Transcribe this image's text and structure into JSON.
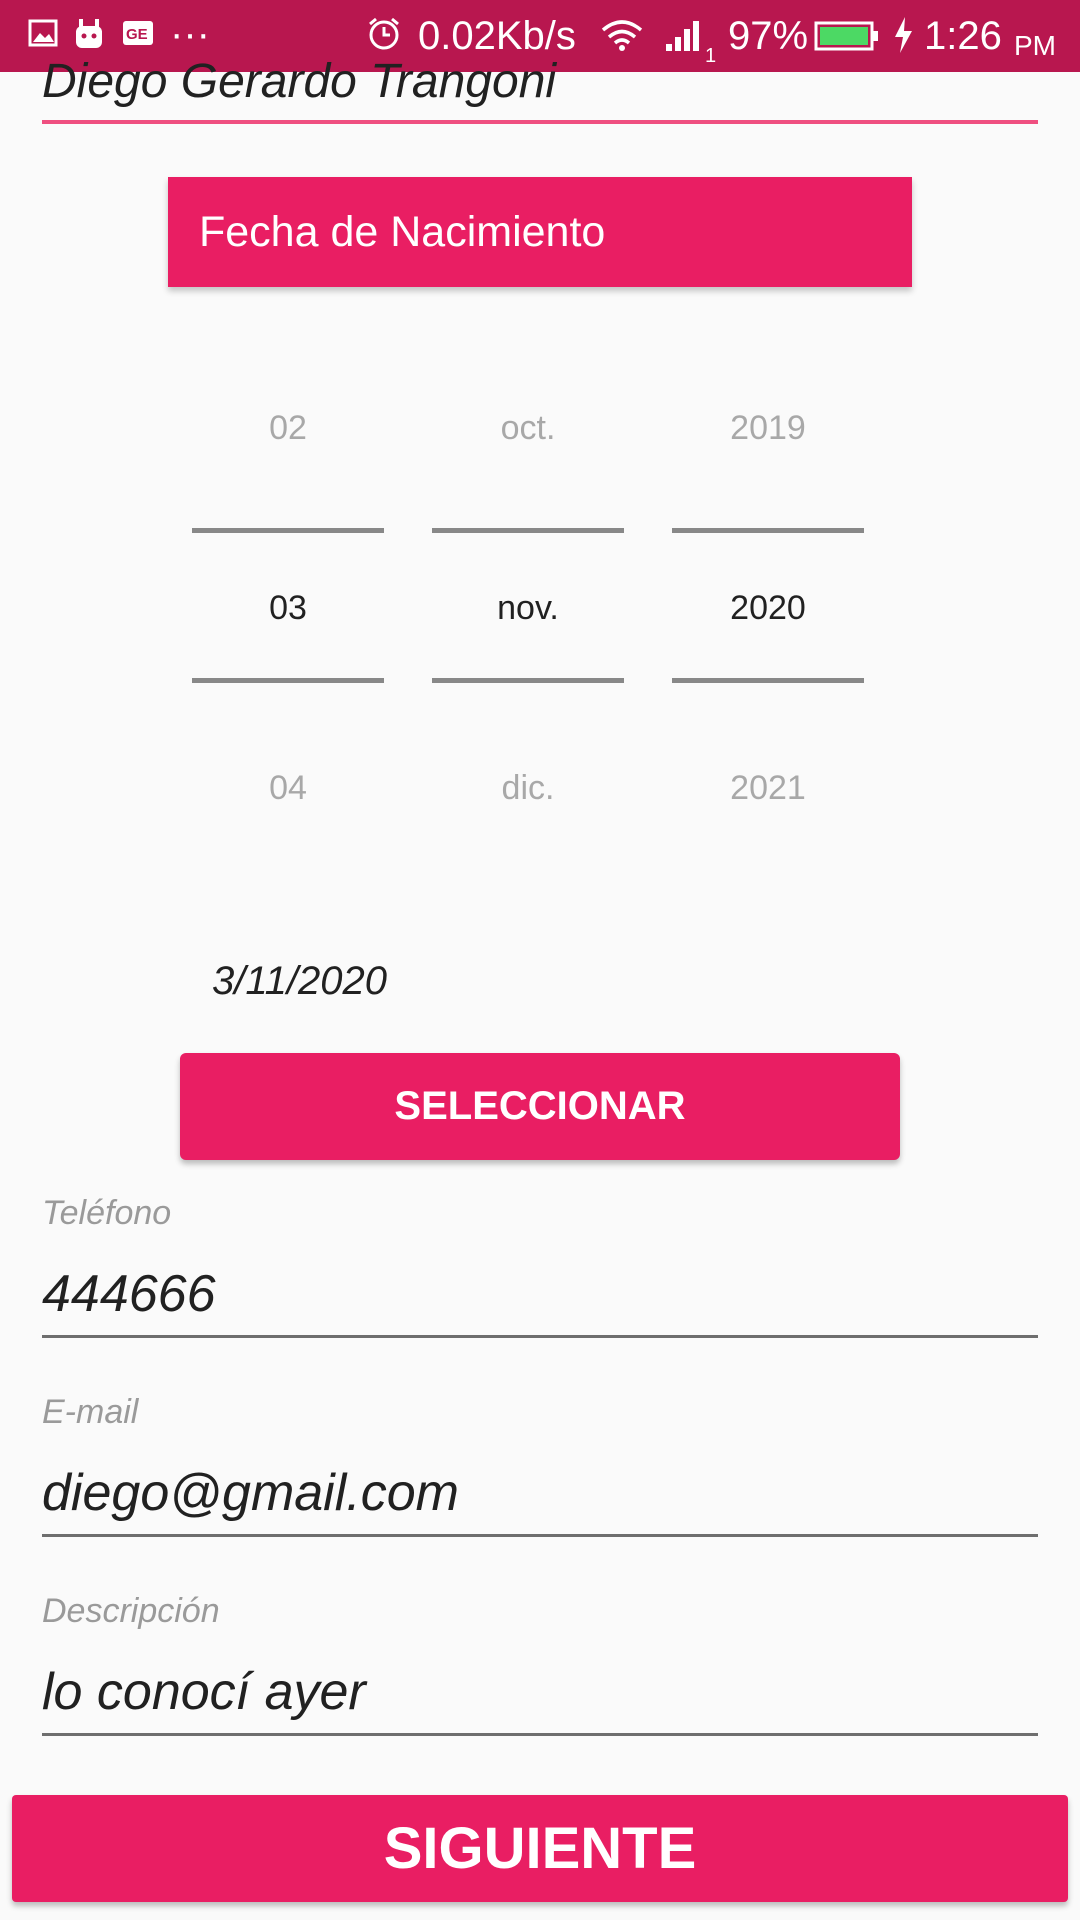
{
  "status_bar": {
    "network_speed": "0.02Kb/s",
    "signal_sub": "1",
    "battery": "97%",
    "time": "1:26",
    "ampm": "PM",
    "icons": [
      "image-icon",
      "android-icon",
      "ge-icon",
      "more-icon",
      "alarm-icon",
      "wifi-icon",
      "signal-icon",
      "battery-icon",
      "charging-icon"
    ],
    "more": "···"
  },
  "form": {
    "name_value": "Diego Gerardo Trangoni",
    "dob_header": "Fecha de Nacimiento",
    "picker": {
      "prev": {
        "day": "02",
        "month": "oct.",
        "year": "2019"
      },
      "selected": {
        "day": "03",
        "month": "nov.",
        "year": "2020"
      },
      "next": {
        "day": "04",
        "month": "dic.",
        "year": "2021"
      }
    },
    "selected_date": "3/11/2020",
    "select_button": "SELECCIONAR",
    "phone": {
      "label": "Teléfono",
      "value": "444666"
    },
    "email": {
      "label": "E-mail",
      "value": "diego@gmail.com"
    },
    "description": {
      "label": "Descripción",
      "value": "lo conocí ayer"
    },
    "next_button": "SIGUIENTE"
  },
  "colors": {
    "status_bar": "#b8174f",
    "accent": "#e91e63",
    "battery": "#4cd964"
  }
}
